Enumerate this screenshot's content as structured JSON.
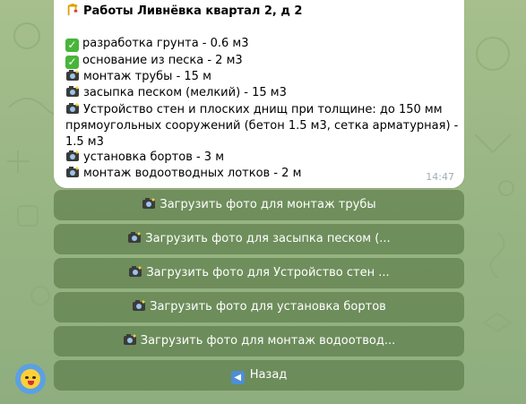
{
  "message": {
    "title_icon": "crane-icon",
    "title": "Работы Ливнёвка квартал 2, д 2",
    "lines": [
      {
        "icon": "check-icon",
        "text": "разработка грунта - 0.6 м3"
      },
      {
        "icon": "check-icon",
        "text": "основание из песка - 2 м3"
      },
      {
        "icon": "camera-icon",
        "text": "монтаж трубы - 15 м"
      },
      {
        "icon": "camera-icon",
        "text": "засыпка песком (мелкий) - 15 м3"
      },
      {
        "icon": "camera-icon",
        "text": "Устройство стен и плоских днищ при толщине: до 150 мм"
      },
      {
        "icon": "",
        "text": "прямоугольных сооружений (бетон 1.5 м3, сетка арматурная) -"
      },
      {
        "icon": "",
        "text": "1.5 м3"
      },
      {
        "icon": "camera-icon",
        "text": "установка бортов - 3 м"
      },
      {
        "icon": "camera-icon",
        "text": "монтаж водоотводных лотков - 2 м"
      }
    ],
    "time": "14:47"
  },
  "keyboard": [
    {
      "icon": "camera-icon",
      "label": "Загрузить фото для монтаж трубы"
    },
    {
      "icon": "camera-icon",
      "label": "Загрузить фото для засыпка песком (..."
    },
    {
      "icon": "camera-icon",
      "label": "Загрузить фото для Устройство стен ..."
    },
    {
      "icon": "camera-icon",
      "label": "Загрузить фото для установка бортов"
    },
    {
      "icon": "camera-icon",
      "label": "Загрузить фото для монтаж водоотвод..."
    },
    {
      "icon": "back-arrow-icon",
      "label": "Назад"
    }
  ],
  "avatar_icon": "sticker-emoji-icon",
  "colors": {
    "background": "#9fb98a",
    "bubble": "#ffffff",
    "button": "#5a7f48",
    "check": "#48b53a",
    "time": "#a0acb6"
  }
}
